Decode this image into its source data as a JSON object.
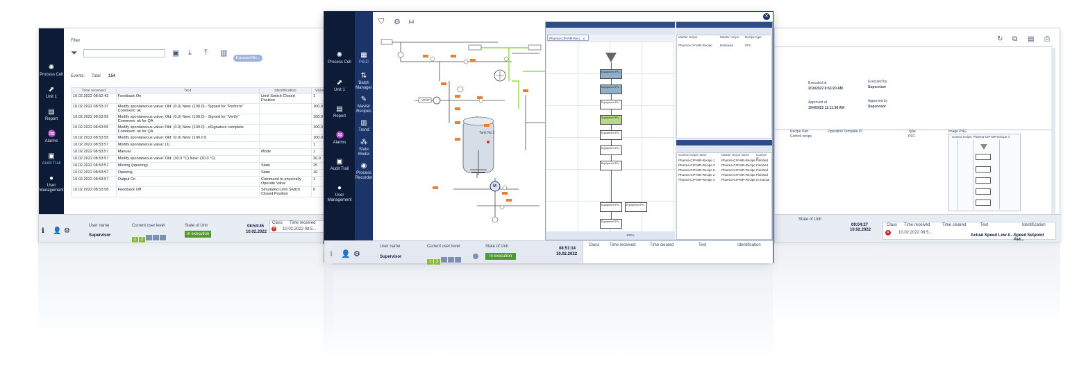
{
  "left_window": {
    "filter_label": "Filter",
    "extended_filter_label": "Extended filte...",
    "events_label": "Events:",
    "total_label": "Total",
    "total_count": "154",
    "nav": [
      {
        "label": "Process Cell",
        "icon": "process-cell-icon"
      },
      {
        "label": "Unit 1",
        "icon": "unit-icon"
      },
      {
        "label": "Report",
        "icon": "report-icon"
      },
      {
        "label": "Alarms",
        "icon": "alarms-icon"
      },
      {
        "label": "Audit Trail",
        "icon": "audit-trail-icon"
      },
      {
        "label": "User Management",
        "icon": "user-icon"
      }
    ],
    "columns": [
      "Time received",
      "Text",
      "Identification",
      "Value"
    ],
    "rows": [
      {
        "time": "10.02.2022 08:52:42",
        "text": "Feedback On",
        "ident": "Limit Switch Closed Position",
        "value": "1"
      },
      {
        "time": "10.02.2022 08:53:37",
        "text": "Modify spontaneous value: Old: (0.0) New: (100.0) - Signed for \"Perform\" Comment: ok",
        "ident": "",
        "value": "100.0"
      },
      {
        "time": "10.02.2022 08:53:55",
        "text": "Modify spontaneous value: Old: (0.0) New: (100.0) - Signed for \"Verify\" Comment: ok for QA",
        "ident": "",
        "value": "100.0"
      },
      {
        "time": "10.02.2022 08:53:55",
        "text": "Modify spontaneous value: Old: (0.0) New: (100.0) - eSignature complete Comment: ok for QA",
        "ident": "",
        "value": "100.0"
      },
      {
        "time": "10.02.2022 08:53:55",
        "text": "Modify spontaneous value: Old: (0.0) New: (100.0 l)",
        "ident": "",
        "value": "100.0"
      },
      {
        "time": "10.02.2022 08:53:57",
        "text": "Modify spontaneous value: (1)",
        "ident": "",
        "value": "1"
      },
      {
        "time": "10.02.2022 08:53:57",
        "text": "Manual",
        "ident": "Mode",
        "value": "1"
      },
      {
        "time": "10.02.2022 08:53:57",
        "text": "Modify spontaneous value: Old: (30.0 °C) New: (30.0 °C)",
        "ident": "",
        "value": "30.0"
      },
      {
        "time": "10.02.2022 08:53:57",
        "text": "Moving (opening)",
        "ident": "State",
        "value": "25"
      },
      {
        "time": "10.02.2022 08:53:57",
        "text": "Opening",
        "ident": "State",
        "value": "10"
      },
      {
        "time": "10.02.2022 08:53:57",
        "text": "Output On",
        "ident": "Command to physically Operate Valve",
        "value": "1"
      },
      {
        "time": "10.02.2022 08:53:58",
        "text": "Feedback Off",
        "ident": "Simulated Limit Switch Closed Position",
        "value": "0"
      }
    ],
    "status": {
      "user_name_label": "User name",
      "user_name": "Supervisor",
      "user_level_label": "Current user level",
      "levels": [
        "1",
        "2",
        "",
        "",
        ""
      ],
      "state_label": "State of Unit",
      "state": "In execution",
      "time": "08:54:45",
      "date": "10.02.2022",
      "class_label": "Class",
      "time_received_label": "Time received",
      "alarm_time": "10.02.2022 08:5..."
    }
  },
  "center_window": {
    "nav_main": [
      {
        "label": "Process Cell",
        "icon": "process-cell-icon"
      },
      {
        "label": "Unit 1",
        "icon": "unit-icon"
      },
      {
        "label": "Report",
        "icon": "report-icon"
      },
      {
        "label": "Alarms",
        "icon": "alarms-icon"
      },
      {
        "label": "Audit Trail",
        "icon": "audit-trail-icon"
      },
      {
        "label": "User Management",
        "icon": "user-icon"
      }
    ],
    "nav_sub": [
      {
        "label": "P&ID",
        "icon": "pid-icon"
      },
      {
        "label": "Batch Manager",
        "icon": "batch-manager-icon"
      },
      {
        "label": "Master Recipes",
        "icon": "master-recipes-icon"
      },
      {
        "label": "Trend",
        "icon": "trend-icon"
      },
      {
        "label": "State Model",
        "icon": "state-model-icon"
      },
      {
        "label": "Process Recorder",
        "icon": "process-recorder-icon"
      }
    ],
    "pid": {
      "tank_label": "Tank No.2",
      "vent_label": "VENT",
      "motor_label": "M"
    },
    "recipe": {
      "tab_label": "Pharma-CIP-RM-Reci... x",
      "steps": [
        "Equipment Ph...",
        "Equipment Ph...",
        "Equipment Ph...",
        "Equipment Ph...",
        "Equipment Ph...",
        "Equipment Ph...",
        "Equipment Ph...",
        "Equipment Ph...",
        "Equipment Ph...",
        "Equipment Ph..."
      ],
      "zoom": "100%",
      "master_list": {
        "columns": [
          "Master recipe",
          "Master recipe",
          "Recipe type"
        ],
        "rows": [
          [
            "Pharma-CIP-MR-Recipe",
            "Released",
            "PFC"
          ]
        ]
      },
      "control_list": {
        "columns": [
          "Control recipe name",
          "Master recipe name",
          "Control st..."
        ],
        "rows": [
          [
            "Pharma-CIP-MR-Recipe 1",
            "Pharma-CIP-MR-Recipe",
            "Finished"
          ],
          [
            "Pharma-CIP-MR-Recipe 3",
            "Pharma-CIP-MR-Recipe",
            "Finished"
          ],
          [
            "Pharma-CIP-MR-Recipe 5",
            "Pharma-CIP-MR-Recipe",
            "Finished"
          ],
          [
            "Pharma-CIP-MR-Recipe 2",
            "Pharma-CIP-MR-Recipe",
            "Finished"
          ],
          [
            "Pharma-CIP-MR-Recipe 4",
            "Pharma-CIP-MR-Recipe",
            "In executi"
          ]
        ]
      }
    },
    "status": {
      "user_name_label": "User name",
      "user_name": "Supervisor",
      "user_level_label": "Current user level",
      "levels": [
        "1",
        "2",
        "",
        "",
        ""
      ],
      "state_label": "State of Unit",
      "state": "In execution",
      "time": "08:51:14",
      "date": "10.02.2022",
      "alarm_columns": [
        "Class",
        "Time received",
        "Time cleared",
        "Text",
        "Identification"
      ]
    }
  },
  "right_window": {
    "executed_at_label": "Executed at",
    "executed_at": "2/10/2022 8:53:20 AM",
    "executed_by_label": "Executed by",
    "executed_by": "Supervisor",
    "approved_at_label": "Approved at",
    "approved_at": "1/04/2022 11:11:38 AM",
    "approved_by_label": "Approved by",
    "approved_by": "Supervisor",
    "columns": [
      "Recipe Part",
      "Operation Template ID",
      "Type",
      "Image PNG"
    ],
    "row": {
      "part": "Control recipe",
      "type": "PFC"
    },
    "image_title": "Control recipe: Pharma-CIP-MR-Recipe 4",
    "status": {
      "state_label": "State of Unit",
      "time": "09:04:27",
      "date": "10.02.2022",
      "class_label": "Class",
      "time_received_label": "Time received",
      "time_cleared_label": "Time cleared",
      "text_label": "Text",
      "identification_label": "Identification",
      "alarm_time": "10.02.2022 08:5...",
      "alarm_text": "Actual Speed Low A...",
      "alarm_ident": "Speed Setpoint Aut..."
    }
  }
}
